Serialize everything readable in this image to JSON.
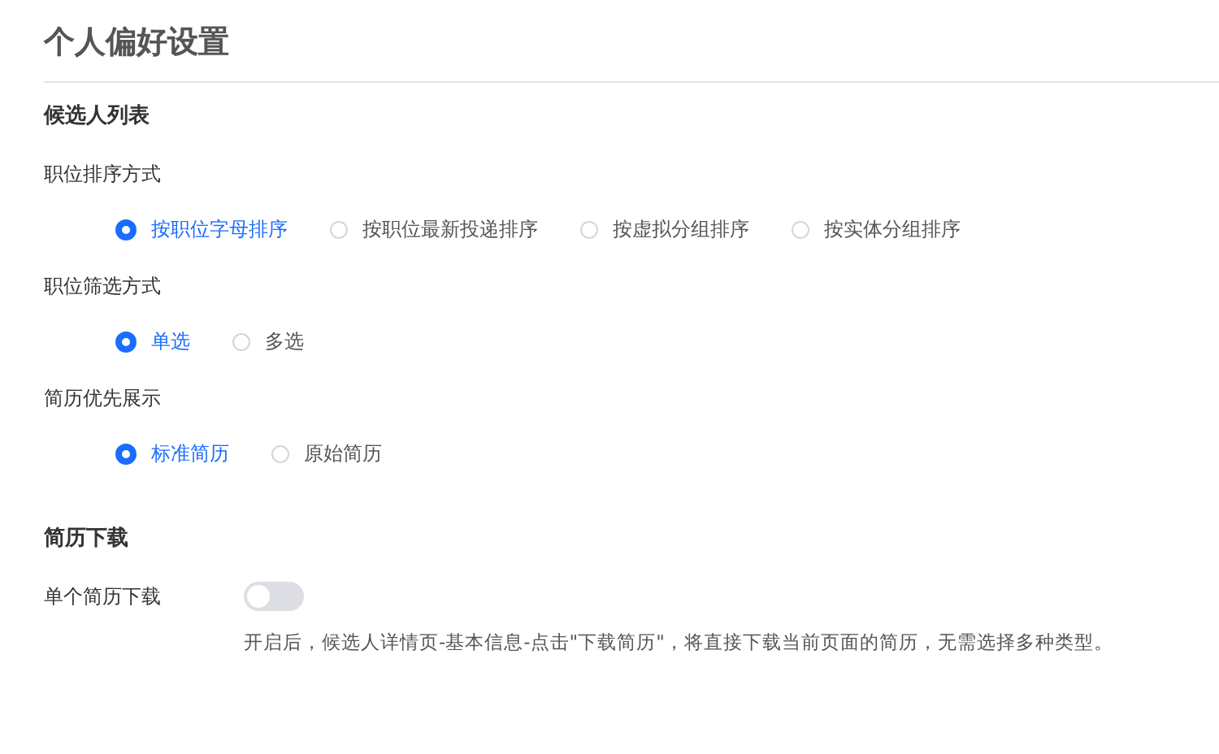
{
  "title": "个人偏好设置",
  "sections": [
    {
      "heading": "候选人列表",
      "groups": [
        {
          "kind": "radio",
          "label": "职位排序方式",
          "options": [
            {
              "label": "按职位字母排序",
              "selected": true
            },
            {
              "label": "按职位最新投递排序",
              "selected": false
            },
            {
              "label": "按虚拟分组排序",
              "selected": false
            },
            {
              "label": "按实体分组排序",
              "selected": false
            }
          ]
        },
        {
          "kind": "radio",
          "label": "职位筛选方式",
          "options": [
            {
              "label": "单选",
              "selected": true
            },
            {
              "label": "多选",
              "selected": false
            }
          ]
        },
        {
          "kind": "radio",
          "label": "简历优先展示",
          "options": [
            {
              "label": "标准简历",
              "selected": true
            },
            {
              "label": "原始简历",
              "selected": false
            }
          ]
        }
      ]
    },
    {
      "heading": "简历下载",
      "groups": [
        {
          "kind": "toggle",
          "label": "单个简历下载",
          "on": false,
          "description": "开启后，候选人详情页-基本信息-点击\"下载简历\"，将直接下载当前页面的简历，无需选择多种类型。"
        }
      ]
    }
  ]
}
